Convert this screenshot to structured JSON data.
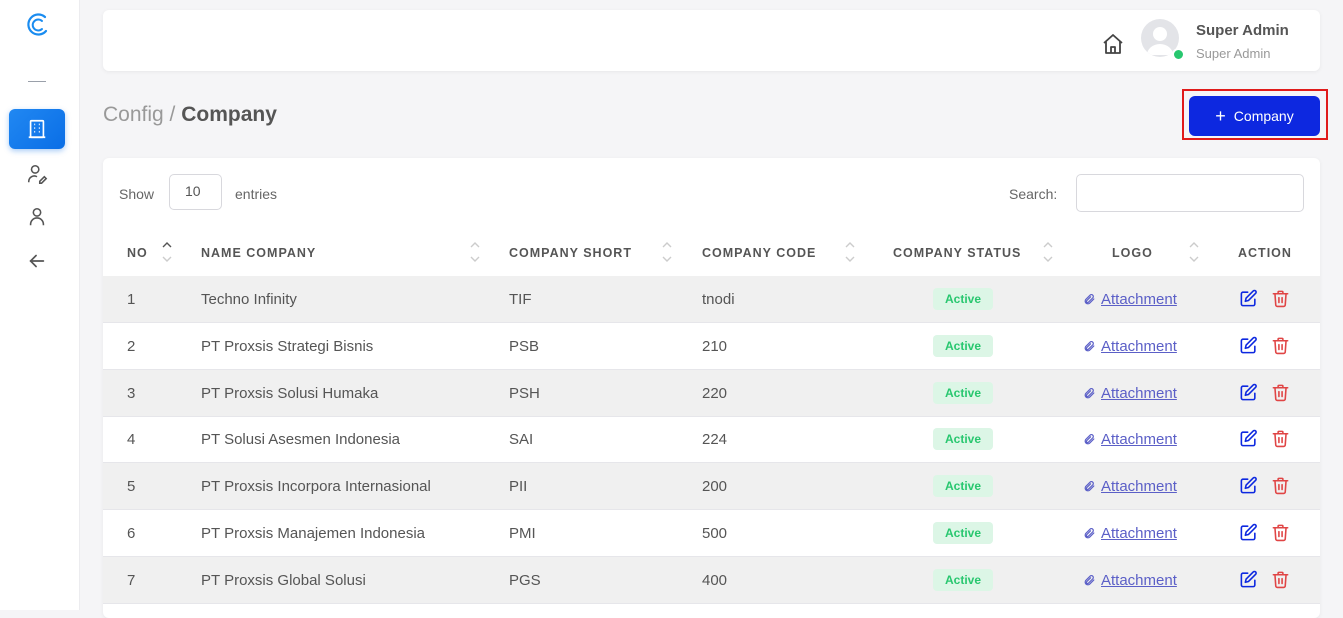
{
  "sidebar": {
    "logo_icon": "c-logo-icon",
    "items": [
      {
        "icon": "building-icon",
        "active": true
      },
      {
        "icon": "user-settings-icon",
        "active": false
      },
      {
        "icon": "user-icon",
        "active": false
      },
      {
        "icon": "arrow-left-icon",
        "active": false
      }
    ]
  },
  "header": {
    "user_name": "Super Admin",
    "user_role": "Super Admin",
    "status_color": "#28c76f"
  },
  "breadcrumb": {
    "parent": "Config",
    "separator": " / ",
    "current": "Company"
  },
  "add_button": {
    "icon": "+",
    "label": "Company",
    "color": "#0d28e0"
  },
  "table_controls": {
    "show_label": "Show",
    "entries_value": "10",
    "entries_label": "entries",
    "search_label": "Search:",
    "search_value": ""
  },
  "table": {
    "columns": [
      "NO",
      "NAME COMPANY",
      "COMPANY SHORT",
      "COMPANY CODE",
      "COMPANY STATUS",
      "LOGO",
      "ACTION"
    ],
    "rows": [
      {
        "no": "1",
        "name": "Techno Infinity",
        "short": "TIF",
        "code": "tnodi",
        "status": "Active",
        "logo": "Attachment"
      },
      {
        "no": "2",
        "name": "PT Proxsis Strategi Bisnis",
        "short": "PSB",
        "code": "210",
        "status": "Active",
        "logo": "Attachment"
      },
      {
        "no": "3",
        "name": "PT Proxsis Solusi Humaka",
        "short": "PSH",
        "code": "220",
        "status": "Active",
        "logo": "Attachment"
      },
      {
        "no": "4",
        "name": "PT Solusi Asesmen Indonesia",
        "short": "SAI",
        "code": "224",
        "status": "Active",
        "logo": "Attachment"
      },
      {
        "no": "5",
        "name": "PT Proxsis Incorpora Internasional",
        "short": "PII",
        "code": "200",
        "status": "Active",
        "logo": "Attachment"
      },
      {
        "no": "6",
        "name": "PT Proxsis Manajemen Indonesia",
        "short": "PMI",
        "code": "500",
        "status": "Active",
        "logo": "Attachment"
      },
      {
        "no": "7",
        "name": "PT Proxsis Global Solusi",
        "short": "PGS",
        "code": "400",
        "status": "Active",
        "logo": "Attachment"
      }
    ]
  }
}
